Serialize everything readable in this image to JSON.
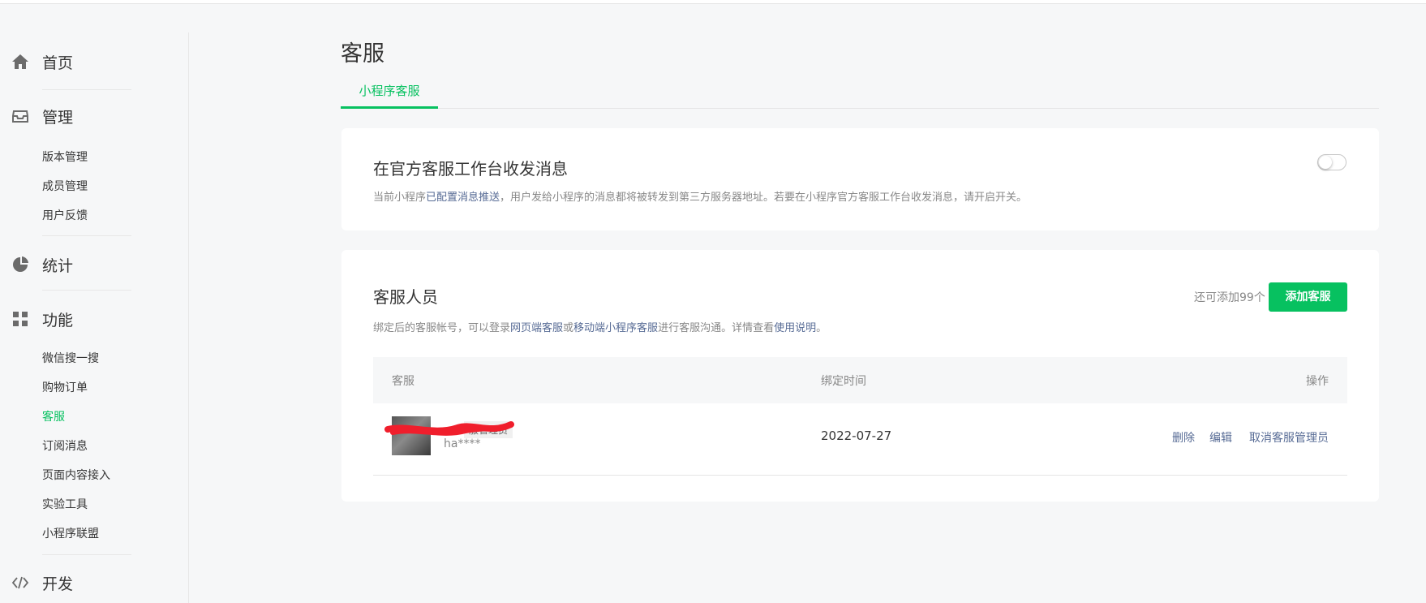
{
  "sidebar": {
    "home": "首页",
    "manage": {
      "label": "管理",
      "items": [
        "版本管理",
        "成员管理",
        "用户反馈"
      ]
    },
    "stats": "统计",
    "features": {
      "label": "功能",
      "items": [
        "微信搜一搜",
        "购物订单",
        "客服",
        "订阅消息",
        "页面内容接入",
        "实验工具",
        "小程序联盟"
      ],
      "active": "客服"
    },
    "dev": "开发"
  },
  "page": {
    "title": "客服",
    "tab": "小程序客服"
  },
  "official": {
    "title": "在官方客服工作台收发消息",
    "desc_before": "当前小程序",
    "desc_link": "已配置消息推送",
    "desc_after": "，用户发给小程序的消息都将被转发到第三方服务器地址。若要在小程序官方客服工作台收发消息，请开启开关。",
    "toggle_on": false
  },
  "staff": {
    "title": "客服人员",
    "desc_before": "绑定后的客服帐号，可以登录",
    "desc_link1": "网页端客服",
    "desc_or": "或",
    "desc_link2": "移动端小程序客服",
    "desc_mid": "进行客服沟通。详情查看",
    "desc_link3": "使用说明",
    "desc_end": "。",
    "remaining": "还可添加99个",
    "add_button": "添加客服",
    "columns": {
      "agent": "客服",
      "bind_time": "绑定时间",
      "actions": "操作"
    },
    "rows": [
      {
        "role": "服管理员",
        "username": "ha****",
        "bind_time": "2022-07-27",
        "actions": {
          "delete": "删除",
          "edit": "编辑",
          "revoke": "取消客服管理员"
        }
      }
    ]
  },
  "colors": {
    "accent": "#07c160",
    "link": "#576b95",
    "redaction": "#f01e2c"
  }
}
